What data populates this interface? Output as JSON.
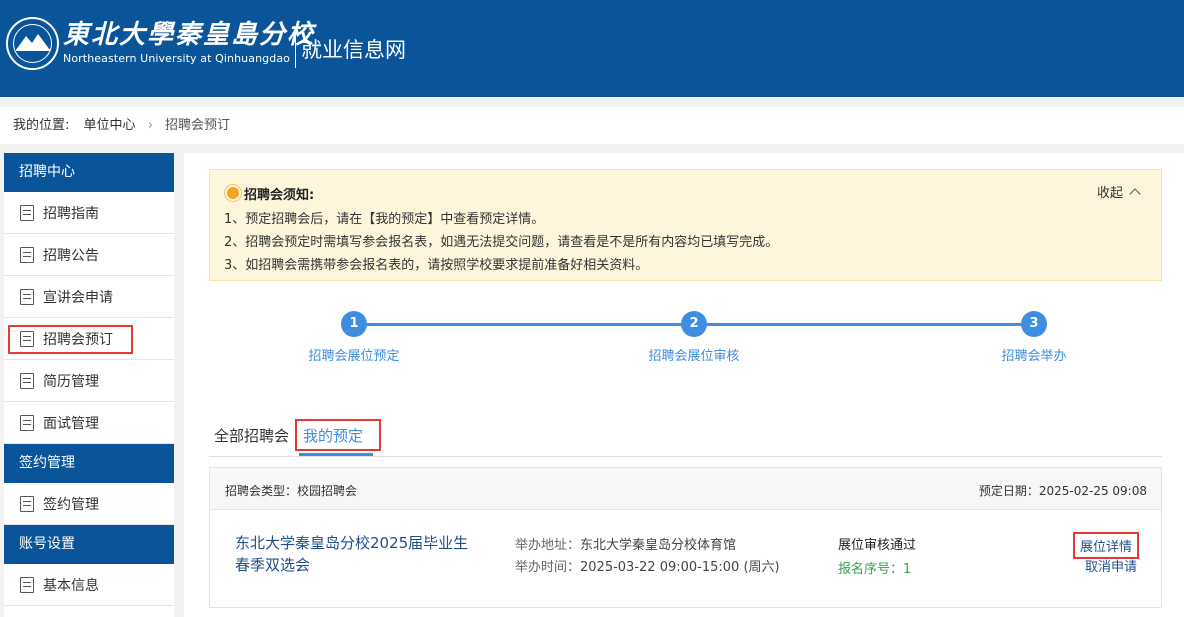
{
  "header": {
    "school_cn": "東北大學秦皇島分校",
    "school_en": "Northeastern University at Qinhuangdao",
    "site_name": "就业信息网"
  },
  "breadcrumb": {
    "label": "我的位置:",
    "parent": "单位中心",
    "current": "招聘会预订"
  },
  "sidebar": {
    "groups": [
      {
        "title": "招聘中心",
        "items": [
          "招聘指南",
          "招聘公告",
          "宣讲会申请",
          "招聘会预订",
          "简历管理",
          "面试管理"
        ]
      },
      {
        "title": "签约管理",
        "items": [
          "签约管理"
        ]
      },
      {
        "title": "账号设置",
        "items": [
          "基本信息"
        ]
      }
    ]
  },
  "notice": {
    "title": "招聘会须知:",
    "collapse_label": "收起",
    "lines": [
      "1、预定招聘会后，请在【我的预定】中查看预定详情。",
      "2、招聘会预定时需填写参会报名表，如遇无法提交问题，请查看是不是所有内容均已填写完成。",
      "3、如招聘会需携带参会报名表的，请按照学校要求提前准备好相关资料。"
    ]
  },
  "steps": [
    {
      "num": "1",
      "label": "招聘会展位预定"
    },
    {
      "num": "2",
      "label": "招聘会展位审核"
    },
    {
      "num": "3",
      "label": "招聘会举办"
    }
  ],
  "tabs": {
    "all": "全部招聘会",
    "mine": "我的预定"
  },
  "card": {
    "type": "招聘会类型：校园招聘会",
    "date": "预定日期：2025-02-25 09:08",
    "title": "东北大学秦皇岛分校2025届毕业生春季双选会",
    "addr_label": "举办地址：",
    "addr": "东北大学秦皇岛分校体育馆",
    "time_label": "举办时间：",
    "time": "2025-03-22 09:00-15:00 (周六)",
    "status": "展位审核通过",
    "regno": "报名序号：1",
    "detail_label": "展位详情",
    "cancel_label": "取消申请"
  },
  "colors": {
    "brand_blue": "#0a5499",
    "accent_blue": "#3d8de0",
    "highlight_red": "#e53935",
    "success_green": "#2ea44f",
    "notice_bg": "#fdf6dc"
  }
}
